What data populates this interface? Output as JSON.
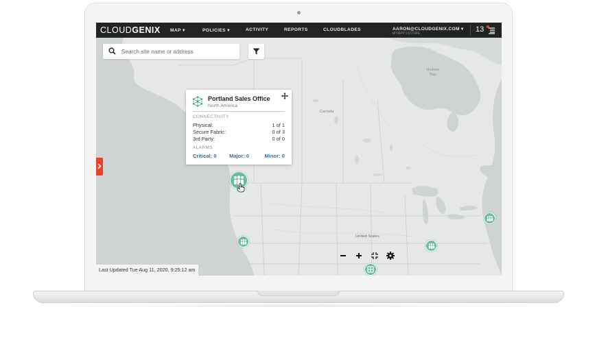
{
  "app": {
    "brand_part1": "CLOUD",
    "brand_part2": "GENIX"
  },
  "nav": {
    "items": [
      {
        "label": "MAP ▾"
      },
      {
        "label": "POLICIES ▾"
      },
      {
        "label": "ACTIVITY"
      },
      {
        "label": "REPORTS"
      },
      {
        "label": "CLOUDBLADES"
      }
    ],
    "user_email": "AARON@CLOUDGENIX.COM ▾",
    "user_sub": "MYAPP1STORE",
    "notification_count": "13"
  },
  "search": {
    "placeholder": "Search site name or address"
  },
  "popup": {
    "title": "Portland Sales Office",
    "subtitle": "North America",
    "connectivity_label": "CONNECTIVITY",
    "rows": [
      {
        "label": "Physical:",
        "value": "1 of 1"
      },
      {
        "label": "Secure Fabric:",
        "value": "0 of 3"
      },
      {
        "label": "3rd Party:",
        "value": "0 of 0"
      }
    ],
    "alarms_label": "ALARMS",
    "alarms": {
      "critical": "Critical: 0",
      "major": "Major: 0",
      "minor": "Minor: 0"
    }
  },
  "map": {
    "labels": {
      "hudson_bay": "Hudson Bay",
      "canada": "Canada",
      "united_states": "United States"
    },
    "last_updated": "Last Updated Tue Aug 11, 2020, 9:25:12 am"
  },
  "colors": {
    "nav_bg": "#222325",
    "accent_red": "#e8412c",
    "marker_green": "#6cbc9f",
    "alarm_blue": "#2f6fb2",
    "land": "#e6e8e7",
    "water": "#cfd3d4"
  },
  "icons": {
    "search": "search-icon",
    "filter": "filter-icon",
    "side_tab": "chevron-right-icon",
    "site": "site-network-icon",
    "move": "move-icon",
    "zoom_out": "minus-icon",
    "zoom_in": "plus-icon",
    "fit": "collapse-icon",
    "settings": "gear-icon",
    "notifications": "list-icon"
  }
}
